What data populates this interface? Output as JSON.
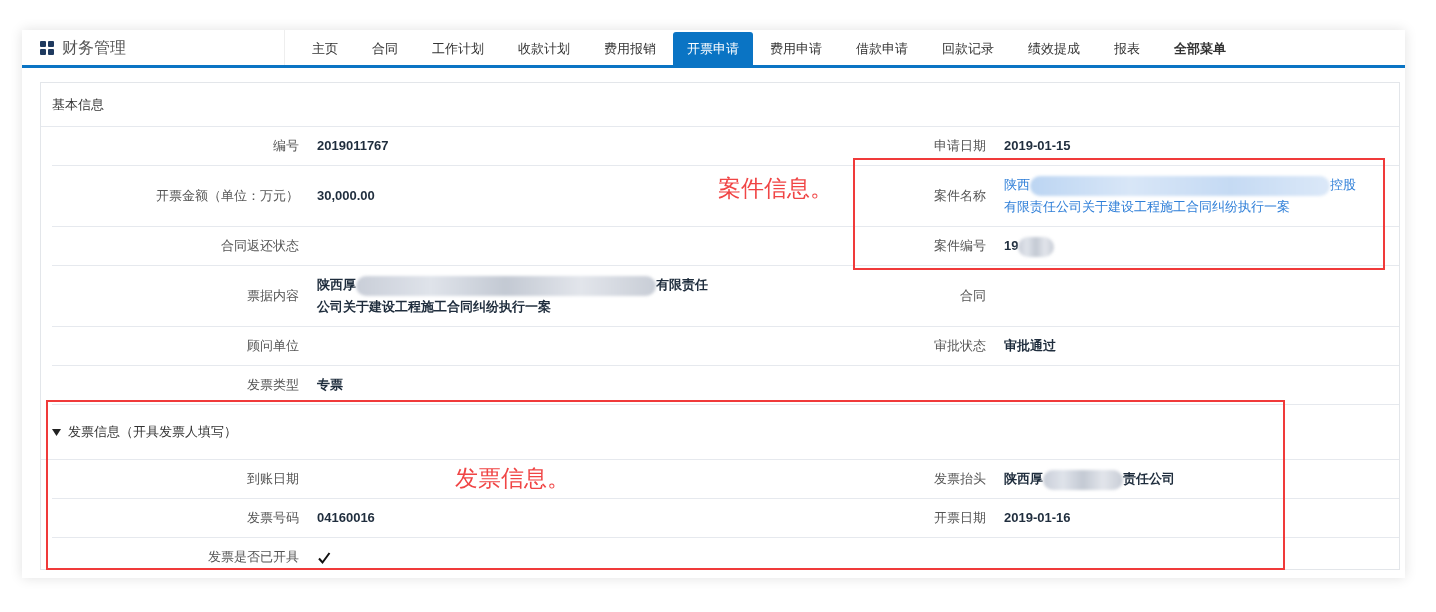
{
  "app": {
    "title": "财务管理"
  },
  "tabs": [
    {
      "label": "主页",
      "kind": "tab",
      "selected": false
    },
    {
      "label": "合同",
      "kind": "tab",
      "selected": false
    },
    {
      "label": "工作计划",
      "kind": "tab",
      "selected": false
    },
    {
      "label": "收款计划",
      "kind": "tab",
      "selected": false
    },
    {
      "label": "费用报销",
      "kind": "tab",
      "selected": false
    },
    {
      "label": "开票申请",
      "kind": "tab",
      "selected": true
    },
    {
      "label": "费用申请",
      "kind": "tab",
      "selected": false
    },
    {
      "label": "借款申请",
      "kind": "tab",
      "selected": false
    },
    {
      "label": "回款记录",
      "kind": "tab",
      "selected": false
    },
    {
      "label": "绩效提成",
      "kind": "tab",
      "selected": false
    },
    {
      "label": "报表",
      "kind": "tab",
      "selected": false
    },
    {
      "label": "全部菜单",
      "kind": "menu",
      "selected": false
    }
  ],
  "sections": [
    {
      "title": "基本信息",
      "kind": "plain",
      "rows": [
        {
          "fields": [
            {
              "label": "编号",
              "kind": "bold",
              "lines": [
                [
                  {
                    "text": "2019011767"
                  }
                ]
              ]
            },
            {
              "label": "申请日期",
              "kind": "bold",
              "lines": [
                [
                  {
                    "text": "2019-01-15"
                  }
                ]
              ]
            }
          ]
        },
        {
          "fields": [
            {
              "label": "开票金额（单位：万元）",
              "kind": "bold",
              "lines": [
                [
                  {
                    "text": "30,000.00"
                  }
                ]
              ]
            },
            {
              "label": "案件名称",
              "kind": "link",
              "lines": [
                [
                  {
                    "kind": "text",
                    "text": "陕西"
                  },
                  {
                    "kind": "blur"
                  },
                  {
                    "kind": "text",
                    "text": "控股"
                  }
                ],
                [
                  {
                    "text": "有限责任公司关于建设工程施工合同纠纷执行一案"
                  }
                ]
              ]
            }
          ]
        },
        {
          "fields": [
            {
              "label": "合同返还状态"
            },
            {
              "label": "案件编号",
              "kind": "bold",
              "lines": [
                [
                  {
                    "kind": "text",
                    "text": "19"
                  },
                  {
                    "kind": "blur"
                  }
                ]
              ]
            }
          ]
        },
        {
          "fields": [
            {
              "label": "票据内容",
              "kind": "bold",
              "lines": [
                [
                  {
                    "kind": "text",
                    "text": "陕西厚"
                  },
                  {
                    "kind": "blur"
                  },
                  {
                    "kind": "text",
                    "text": "有限责任"
                  }
                ],
                [
                  {
                    "text": "公司关于建设工程施工合同纠纷执行一案"
                  }
                ]
              ]
            },
            {
              "label": "合同"
            }
          ]
        },
        {
          "fields": [
            {
              "label": "顾问单位"
            },
            {
              "label": "审批状态",
              "kind": "bold",
              "lines": [
                [
                  {
                    "text": "审批通过"
                  }
                ]
              ]
            }
          ]
        },
        {
          "fields": [
            {
              "label": "发票类型",
              "kind": "bold",
              "lines": [
                [
                  {
                    "text": "专票"
                  }
                ]
              ]
            }
          ]
        }
      ]
    },
    {
      "title": "发票信息（开具发票人填写）",
      "kind": "collapsible",
      "expanded": true,
      "rows": [
        {
          "fields": [
            {
              "label": "到账日期"
            },
            {
              "label": "发票抬头",
              "kind": "bold",
              "lines": [
                [
                  {
                    "kind": "text",
                    "text": "陕西厚"
                  },
                  {
                    "kind": "blur"
                  },
                  {
                    "kind": "text",
                    "text": "责任公司"
                  }
                ]
              ]
            }
          ]
        },
        {
          "fields": [
            {
              "label": "发票号码",
              "kind": "bold",
              "lines": [
                [
                  {
                    "text": "04160016"
                  }
                ]
              ]
            },
            {
              "label": "开票日期",
              "kind": "bold",
              "lines": [
                [
                  {
                    "text": "2019-01-16"
                  }
                ]
              ]
            }
          ]
        },
        {
          "fields": [
            {
              "label": "发票是否已开具",
              "kind": "check",
              "checked": true
            }
          ]
        }
      ]
    }
  ],
  "annotations": [
    {
      "text": "案件信息。",
      "kind": "case"
    },
    {
      "text": "发票信息。",
      "kind": "invoice"
    }
  ]
}
